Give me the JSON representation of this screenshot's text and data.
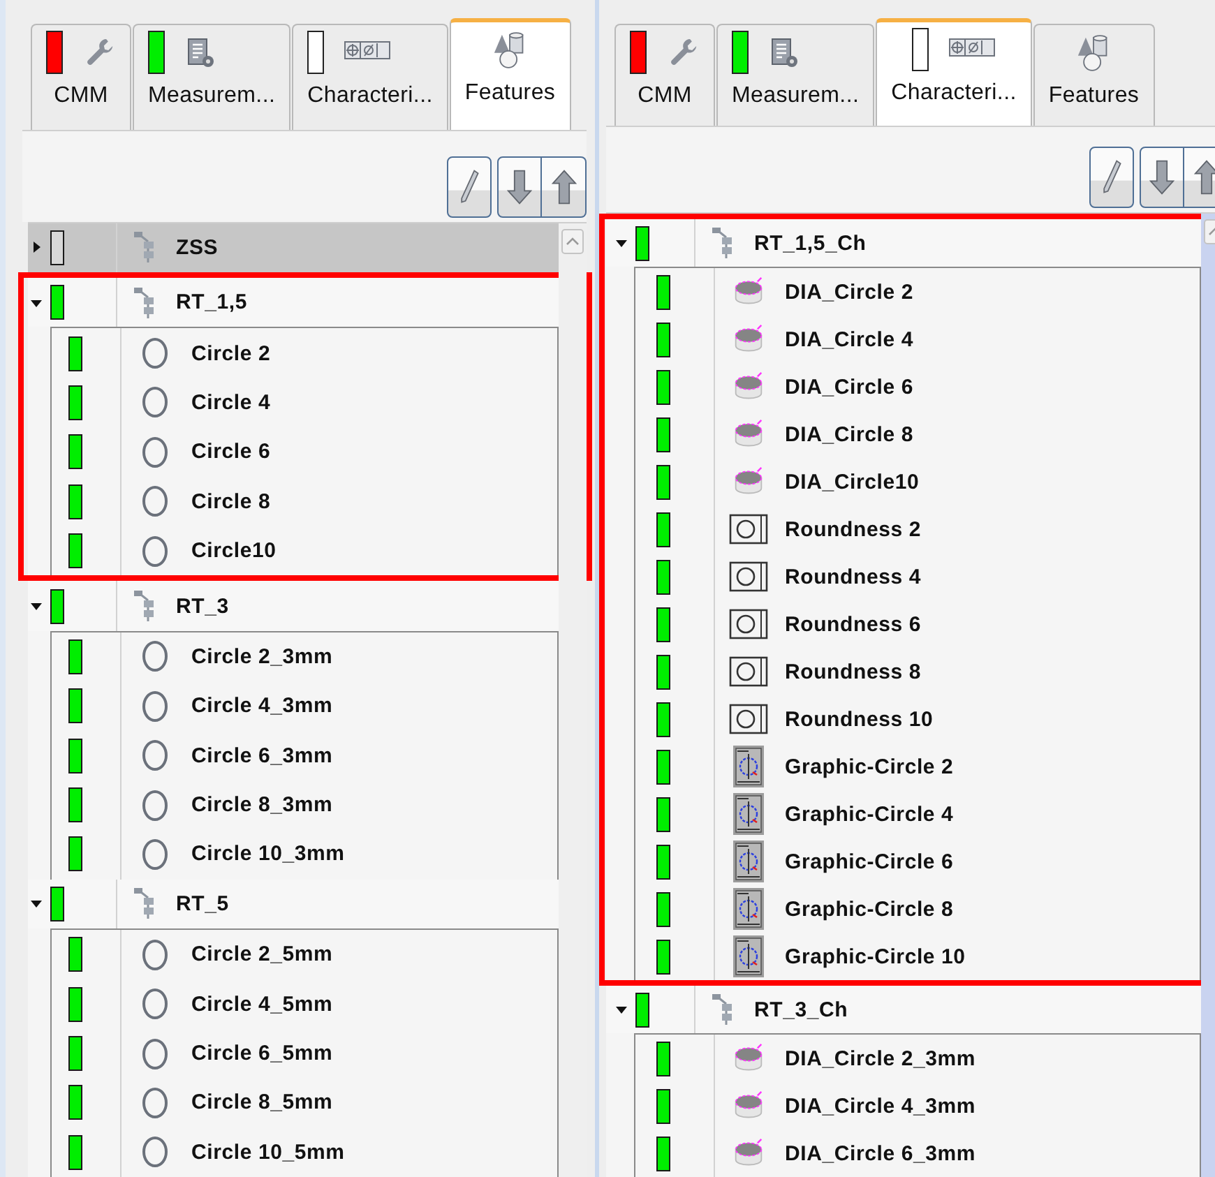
{
  "panels": [
    {
      "tabs": [
        {
          "label": "CMM",
          "kind": "cmm",
          "color": "#ff0000",
          "selected": false
        },
        {
          "label": "Measurem...",
          "kind": "measurement",
          "color": "#00ee00",
          "selected": false
        },
        {
          "label": "Characteri...",
          "kind": "characteristic",
          "color": "#ffffff",
          "selected": false
        },
        {
          "label": "Features",
          "kind": "features",
          "selected": true
        }
      ],
      "tree": [
        {
          "label": "ZSS",
          "color": "#d8d8d8",
          "expanded": false,
          "selected": true,
          "highlighted": false
        },
        {
          "label": "RT_1,5",
          "color": "#00ee00",
          "expanded": true,
          "selected": false,
          "highlighted": true,
          "children": [
            {
              "label": "Circle 2",
              "kind": "circle",
              "color": "#00ee00"
            },
            {
              "label": "Circle 4",
              "kind": "circle",
              "color": "#00ee00"
            },
            {
              "label": "Circle 6",
              "kind": "circle",
              "color": "#00ee00"
            },
            {
              "label": "Circle 8",
              "kind": "circle",
              "color": "#00ee00"
            },
            {
              "label": "Circle10",
              "kind": "circle",
              "color": "#00ee00"
            }
          ]
        },
        {
          "label": "RT_3",
          "color": "#00ee00",
          "expanded": true,
          "selected": false,
          "highlighted": false,
          "children": [
            {
              "label": "Circle 2_3mm",
              "kind": "circle",
              "color": "#00ee00"
            },
            {
              "label": "Circle 4_3mm",
              "kind": "circle",
              "color": "#00ee00"
            },
            {
              "label": "Circle 6_3mm",
              "kind": "circle",
              "color": "#00ee00"
            },
            {
              "label": "Circle 8_3mm",
              "kind": "circle",
              "color": "#00ee00"
            },
            {
              "label": "Circle 10_3mm",
              "kind": "circle",
              "color": "#00ee00"
            }
          ]
        },
        {
          "label": "RT_5",
          "color": "#00ee00",
          "expanded": true,
          "selected": false,
          "highlighted": false,
          "children": [
            {
              "label": "Circle 2_5mm",
              "kind": "circle",
              "color": "#00ee00"
            },
            {
              "label": "Circle 4_5mm",
              "kind": "circle",
              "color": "#00ee00"
            },
            {
              "label": "Circle 6_5mm",
              "kind": "circle",
              "color": "#00ee00"
            },
            {
              "label": "Circle 8_5mm",
              "kind": "circle",
              "color": "#00ee00"
            },
            {
              "label": "Circle 10_5mm",
              "kind": "circle",
              "color": "#00ee00"
            }
          ]
        }
      ]
    },
    {
      "tabs": [
        {
          "label": "CMM",
          "kind": "cmm",
          "color": "#ff0000",
          "selected": false
        },
        {
          "label": "Measurem...",
          "kind": "measurement",
          "color": "#00ee00",
          "selected": false
        },
        {
          "label": "Characteri...",
          "kind": "characteristic",
          "color": "#ffffff",
          "selected": true
        },
        {
          "label": "Features",
          "kind": "features",
          "selected": false
        }
      ],
      "tree": [
        {
          "label": "RT_1,5_Ch",
          "color": "#00ee00",
          "expanded": true,
          "selected": false,
          "highlighted": true,
          "children": [
            {
              "label": "DIA_Circle 2",
              "kind": "diameter",
              "color": "#00ee00"
            },
            {
              "label": "DIA_Circle 4",
              "kind": "diameter",
              "color": "#00ee00"
            },
            {
              "label": "DIA_Circle 6",
              "kind": "diameter",
              "color": "#00ee00"
            },
            {
              "label": "DIA_Circle 8",
              "kind": "diameter",
              "color": "#00ee00"
            },
            {
              "label": "DIA_Circle10",
              "kind": "diameter",
              "color": "#00ee00"
            },
            {
              "label": "Roundness 2",
              "kind": "roundness",
              "color": "#00ee00"
            },
            {
              "label": "Roundness 4",
              "kind": "roundness",
              "color": "#00ee00"
            },
            {
              "label": "Roundness 6",
              "kind": "roundness",
              "color": "#00ee00"
            },
            {
              "label": "Roundness 8",
              "kind": "roundness",
              "color": "#00ee00"
            },
            {
              "label": "Roundness 10",
              "kind": "roundness",
              "color": "#00ee00"
            },
            {
              "label": "Graphic-Circle 2",
              "kind": "graphic",
              "color": "#00ee00"
            },
            {
              "label": "Graphic-Circle 4",
              "kind": "graphic",
              "color": "#00ee00"
            },
            {
              "label": "Graphic-Circle 6",
              "kind": "graphic",
              "color": "#00ee00"
            },
            {
              "label": "Graphic-Circle 8",
              "kind": "graphic",
              "color": "#00ee00"
            },
            {
              "label": "Graphic-Circle 10",
              "kind": "graphic",
              "color": "#00ee00"
            }
          ]
        },
        {
          "label": "RT_3_Ch",
          "color": "#00ee00",
          "expanded": true,
          "selected": false,
          "highlighted": false,
          "children": [
            {
              "label": "DIA_Circle 2_3mm",
              "kind": "diameter",
              "color": "#00ee00"
            },
            {
              "label": "DIA_Circle 4_3mm",
              "kind": "diameter",
              "color": "#00ee00"
            },
            {
              "label": "DIA_Circle 6_3mm",
              "kind": "diameter",
              "color": "#00ee00"
            }
          ]
        }
      ]
    }
  ]
}
